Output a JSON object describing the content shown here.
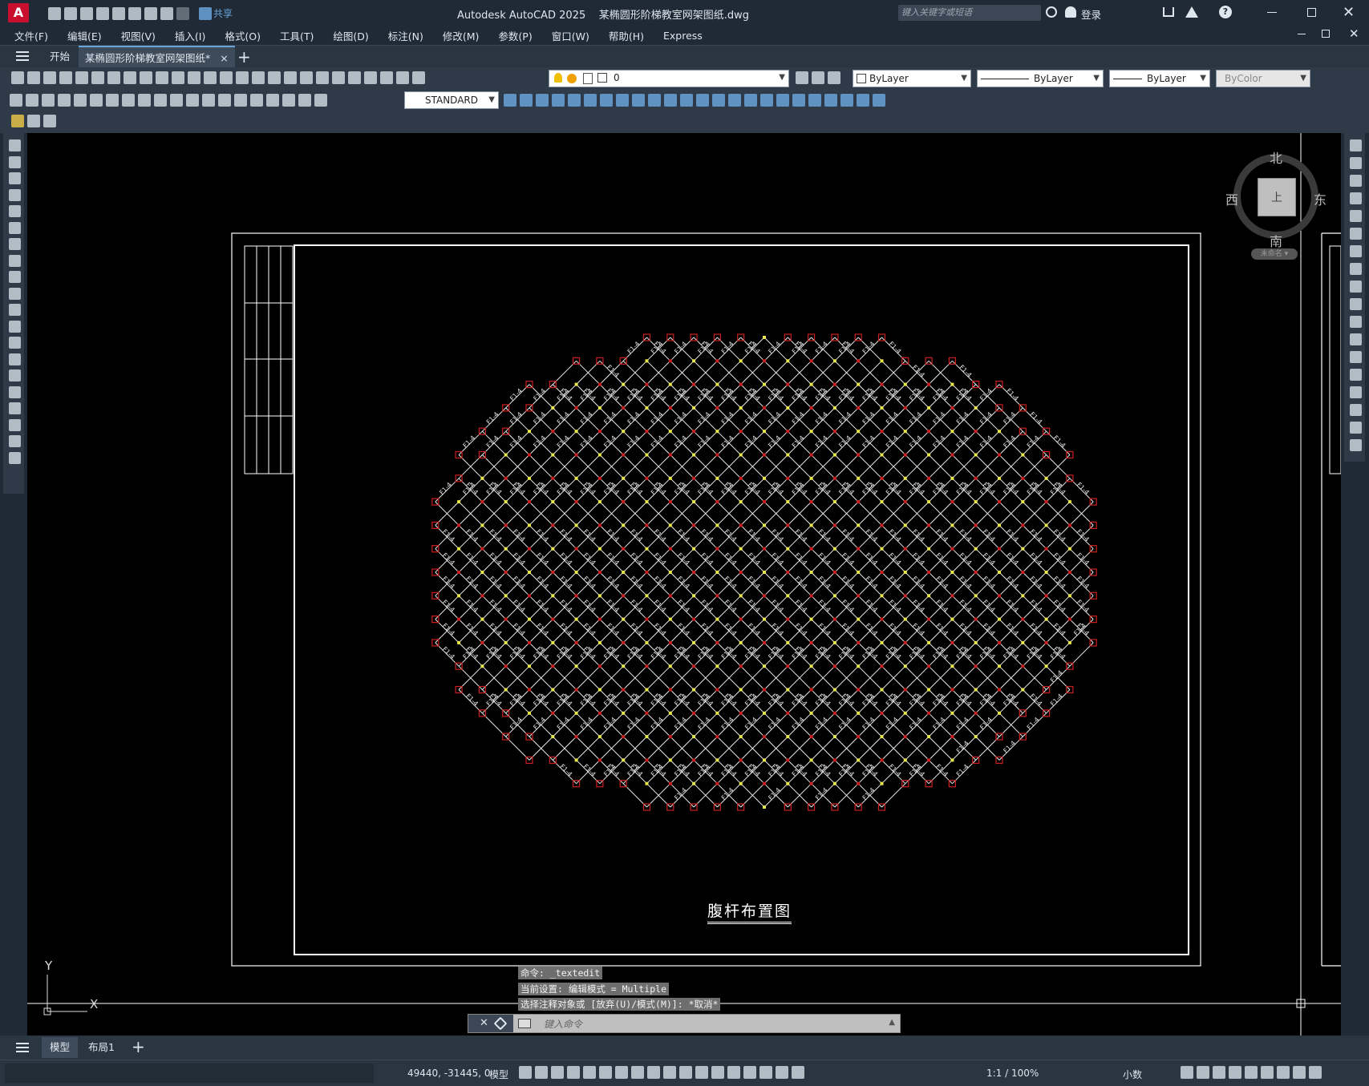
{
  "app": {
    "title": "Autodesk AutoCAD 2025    某椭圆形阶梯教室网架图纸.dwg",
    "share_label": "共享",
    "search_placeholder": "键入关键字或短语",
    "login_label": "登录"
  },
  "menu": [
    "文件(F)",
    "编辑(E)",
    "视图(V)",
    "插入(I)",
    "格式(O)",
    "工具(T)",
    "绘图(D)",
    "标注(N)",
    "修改(M)",
    "参数(P)",
    "窗口(W)",
    "帮助(H)",
    "Express"
  ],
  "tabs": {
    "start": "开始",
    "active": "某椭圆形阶梯教室网架图纸*",
    "close": "×",
    "add": "+"
  },
  "properties": {
    "layer": "0",
    "color": "ByLayer",
    "linetype": "ByLayer",
    "lineweight": "ByLayer",
    "plotstyle": "ByColor",
    "text_style": "STANDARD"
  },
  "viewcube": {
    "north": "北",
    "south": "南",
    "east": "东",
    "west": "西",
    "face": "上",
    "wcs": "未命名"
  },
  "drawing": {
    "title": "腹杆布置图",
    "ucs_x": "X",
    "ucs_y": "Y",
    "member_label": "F1-4"
  },
  "command": {
    "history": [
      "命令: _textedit",
      "当前设置: 编辑模式 = Multiple",
      "选择注释对象或 [放弃(U)/模式(M)]: *取消*"
    ],
    "placeholder": "键入命令"
  },
  "layout_tabs": [
    "模型",
    "布局1"
  ],
  "status": {
    "coords": "49440, -31445, 0",
    "model": "模型",
    "scale": "1:1 / 100%",
    "units": "小数"
  },
  "colors": {
    "accent": "#e8e84a",
    "node_red": "#cc2020",
    "frame": "#ffffff",
    "canvas": "#000000"
  }
}
